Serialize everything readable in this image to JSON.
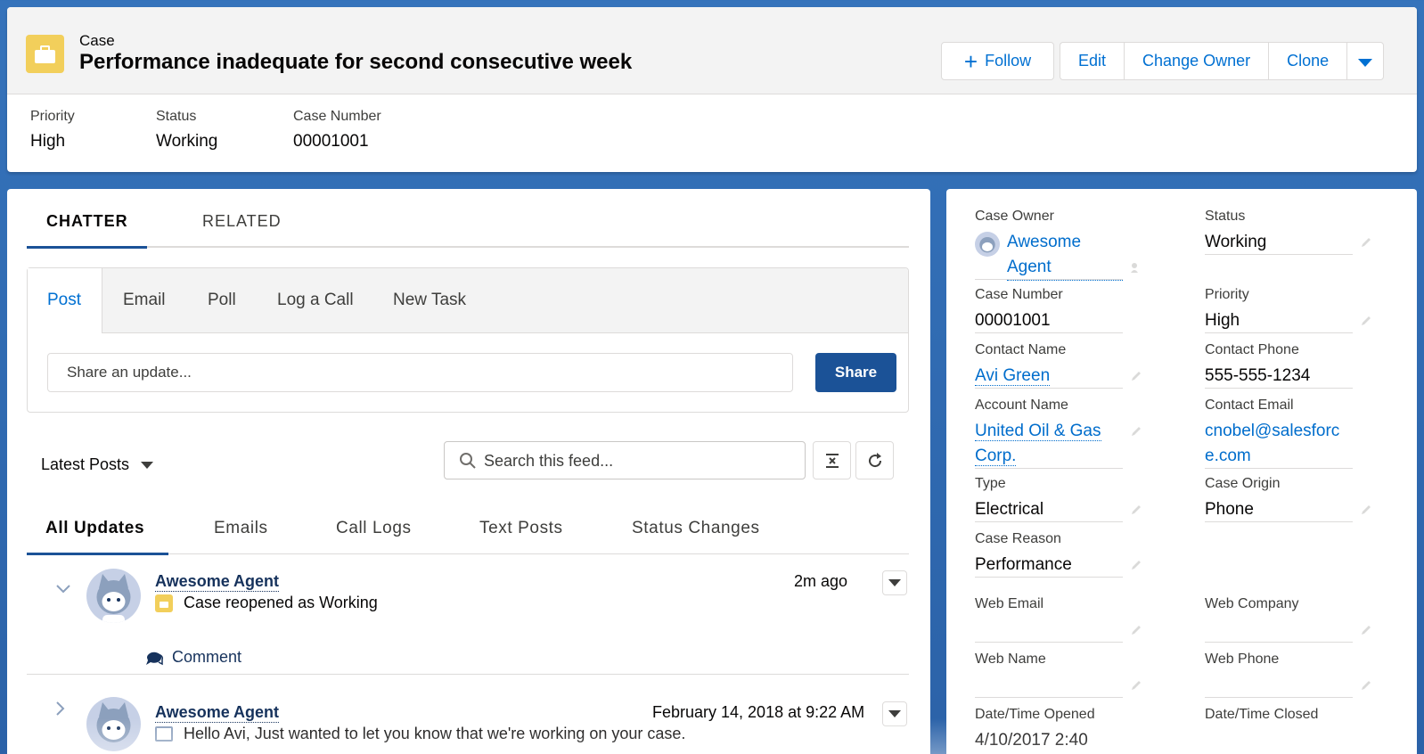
{
  "header": {
    "object_label": "Case",
    "title": "Performance inadequate for second consecutive week",
    "buttons": {
      "follow": "Follow",
      "edit": "Edit",
      "change_owner": "Change Owner",
      "clone": "Clone"
    },
    "highlights": [
      {
        "label": "Priority",
        "value": "High"
      },
      {
        "label": "Status",
        "value": "Working"
      },
      {
        "label": "Case Number",
        "value": "00001001"
      }
    ]
  },
  "tabs": {
    "chatter": "CHATTER",
    "related": "RELATED"
  },
  "publisher": {
    "tabs": [
      "Post",
      "Email",
      "Poll",
      "Log a Call",
      "New Task"
    ],
    "input_placeholder": "Share an update...",
    "share_label": "Share"
  },
  "feed": {
    "sort_label": "Latest Posts",
    "search_placeholder": "Search this feed...",
    "filter_tabs": [
      "All Updates",
      "Emails",
      "Call Logs",
      "Text Posts",
      "Status Changes"
    ],
    "items": [
      {
        "actor": "Awesome Agent",
        "time": "2m ago",
        "body": "Case reopened as Working",
        "icon": "case-icon",
        "comment_label": "Comment"
      },
      {
        "actor": "Awesome Agent",
        "time": "February 14, 2018 at 9:22 AM",
        "body": "Hello Avi,  Just wanted to let you know that we're working on your case.",
        "icon": "email-icon"
      }
    ]
  },
  "details": {
    "case_owner": {
      "label": "Case Owner",
      "value": "Awesome Agent"
    },
    "status": {
      "label": "Status",
      "value": "Working"
    },
    "case_number": {
      "label": "Case Number",
      "value": "00001001"
    },
    "priority": {
      "label": "Priority",
      "value": "High"
    },
    "contact_name": {
      "label": "Contact Name",
      "value": "Avi Green"
    },
    "contact_phone": {
      "label": "Contact Phone",
      "value": "555-555-1234"
    },
    "account_name": {
      "label": "Account Name",
      "value": "United Oil & Gas Corp."
    },
    "contact_email": {
      "label": "Contact Email",
      "value": "cnobel@salesforce.com"
    },
    "type": {
      "label": "Type",
      "value": "Electrical"
    },
    "case_origin": {
      "label": "Case Origin",
      "value": "Phone"
    },
    "case_reason": {
      "label": "Case Reason",
      "value": "Performance"
    },
    "web_email": {
      "label": "Web Email",
      "value": ""
    },
    "web_company": {
      "label": "Web Company",
      "value": ""
    },
    "web_name": {
      "label": "Web Name",
      "value": ""
    },
    "web_phone": {
      "label": "Web Phone",
      "value": ""
    },
    "date_opened": {
      "label": "Date/Time Opened",
      "value": "4/10/2017 2:40"
    },
    "date_closed": {
      "label": "Date/Time Closed",
      "value": ""
    }
  },
  "colors": {
    "brand_blue": "#1b5297",
    "link_blue": "#006dcc",
    "case_yellow": "#f2cf5b",
    "background": "#2f6ab0"
  }
}
